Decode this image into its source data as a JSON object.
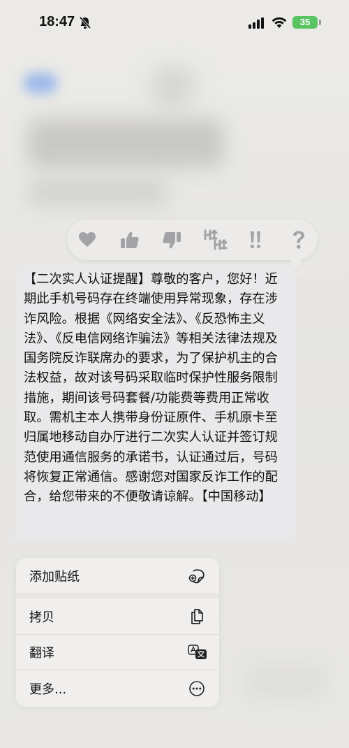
{
  "status_bar": {
    "time": "18:47",
    "battery_level": "35",
    "battery_color": "#5ac463",
    "icons": [
      "bell-slash-icon",
      "signal-icon",
      "wifi-icon",
      "battery-icon"
    ]
  },
  "reactions": [
    {
      "name": "heart-icon"
    },
    {
      "name": "thumbs-up-icon"
    },
    {
      "name": "thumbs-down-icon"
    },
    {
      "name": "haha-icon"
    },
    {
      "name": "exclamation-icon"
    },
    {
      "name": "question-icon"
    }
  ],
  "message": {
    "text": "【二次实人认证提醒】尊敬的客户，您好！近期此手机号码存在终端使用异常现象，存在涉诈风险。根据《网络安全法》、《反恐怖主义法》、《反电信网络诈骗法》等相关法律法规及国务院反诈联席办的要求，为了保护机主的合法权益，故对该号码采取临时保护性服务限制措施，期间该号码套餐/功能费等费用正常收取。需机主本人携带身份证原件、手机原卡至归属地移动自办厅进行二次实人认证并签订规范使用通信服务的承诺书，认证通过后，号码将恢复正常通信。感谢您对国家反诈工作的配合，给您带来的不便敬请谅解。【中国移动】",
    "bubble_color": "#e9e9eb"
  },
  "menu": {
    "items": [
      {
        "label": "添加贴纸",
        "icon": "sticker-icon"
      },
      {
        "label": "拷贝",
        "icon": "copy-icon"
      },
      {
        "label": "翻译",
        "icon": "translate-icon"
      },
      {
        "label": "更多...",
        "icon": "more-icon"
      }
    ]
  }
}
